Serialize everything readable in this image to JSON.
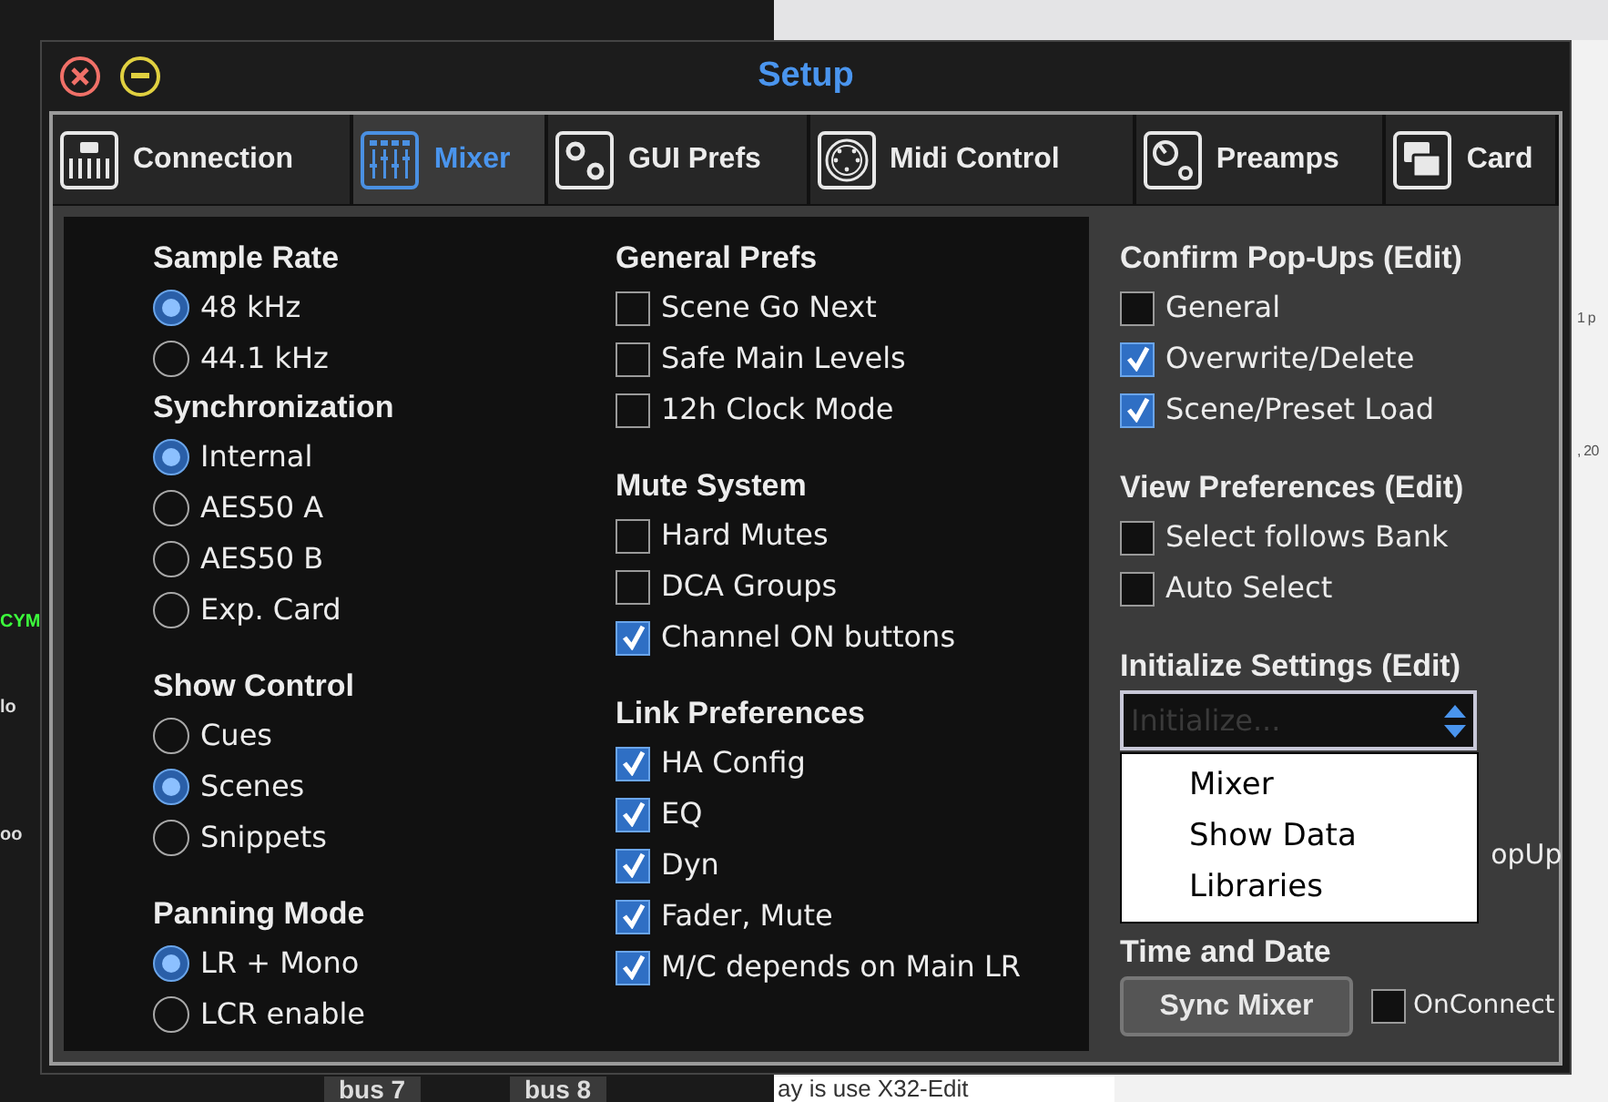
{
  "background": {
    "left_labels": [
      "CYM",
      "lo",
      "oo"
    ],
    "right_labels": [
      "1 p",
      ", 20"
    ],
    "bottom_labels": [
      "bus 7",
      "bus 8"
    ],
    "bottom_text": "ay is use X32-Edit"
  },
  "window": {
    "title": "Setup"
  },
  "tabs": [
    {
      "label": "Connection",
      "selected": false
    },
    {
      "label": "Mixer",
      "selected": true
    },
    {
      "label": "GUI Prefs",
      "selected": false
    },
    {
      "label": "Midi Control",
      "selected": false
    },
    {
      "label": "Preamps",
      "selected": false
    },
    {
      "label": "Card",
      "selected": false
    }
  ],
  "columns": [
    [
      {
        "title": "Sample Rate",
        "kind": "radio",
        "items": [
          {
            "label": "48 kHz",
            "selected": true
          },
          {
            "label": "44.1 kHz",
            "selected": false
          }
        ]
      },
      {
        "title": "Synchronization",
        "kind": "radio",
        "items": [
          {
            "label": "Internal",
            "selected": true
          },
          {
            "label": "AES50 A",
            "selected": false
          },
          {
            "label": "AES50 B",
            "selected": false
          },
          {
            "label": "Exp. Card",
            "selected": false
          }
        ]
      },
      {
        "title": "Show Control",
        "kind": "radio",
        "items": [
          {
            "label": "Cues",
            "selected": false
          },
          {
            "label": "Scenes",
            "selected": true
          },
          {
            "label": "Snippets",
            "selected": false
          }
        ]
      },
      {
        "title": "Panning Mode",
        "kind": "radio",
        "items": [
          {
            "label": "LR + Mono",
            "selected": true
          },
          {
            "label": "LCR enable",
            "selected": false
          }
        ]
      }
    ],
    [
      {
        "title": "General Prefs",
        "kind": "checkbox",
        "items": [
          {
            "label": "Scene Go Next",
            "checked": false
          },
          {
            "label": "Safe Main Levels",
            "checked": false
          },
          {
            "label": "12h Clock Mode",
            "checked": false
          }
        ]
      },
      {
        "title": "Mute System",
        "kind": "checkbox",
        "items": [
          {
            "label": "Hard Mutes",
            "checked": false
          },
          {
            "label": "DCA Groups",
            "checked": false
          },
          {
            "label": "Channel ON buttons",
            "checked": true
          }
        ]
      },
      {
        "title": "Link Preferences",
        "kind": "checkbox",
        "items": [
          {
            "label": "HA Config",
            "checked": true
          },
          {
            "label": "EQ",
            "checked": true
          },
          {
            "label": "Dyn",
            "checked": true
          },
          {
            "label": "Fader, Mute",
            "checked": true
          },
          {
            "label": "M/C depends on Main LR",
            "checked": true
          }
        ]
      }
    ]
  ],
  "right": {
    "sections": [
      {
        "title": "Confirm Pop-Ups (Edit)",
        "kind": "checkbox",
        "items": [
          {
            "label": "General",
            "checked": false
          },
          {
            "label": "Overwrite/Delete",
            "checked": true
          },
          {
            "label": "Scene/Preset Load",
            "checked": true
          }
        ]
      },
      {
        "title": "View Preferences (Edit)",
        "kind": "checkbox",
        "items": [
          {
            "label": "Select follows Bank",
            "checked": false
          },
          {
            "label": "Auto Select",
            "checked": false
          }
        ]
      }
    ],
    "initialize": {
      "title": "Initialize Settings (Edit)",
      "placeholder": "Initialize...",
      "expanded": true,
      "options": [
        "Mixer",
        "Show Data",
        "Libraries"
      ]
    },
    "hidden_label": "opUp",
    "time": {
      "title": "Time and Date",
      "button": "Sync Mixer",
      "checkbox": {
        "label": "OnConnect",
        "checked": false
      }
    }
  }
}
